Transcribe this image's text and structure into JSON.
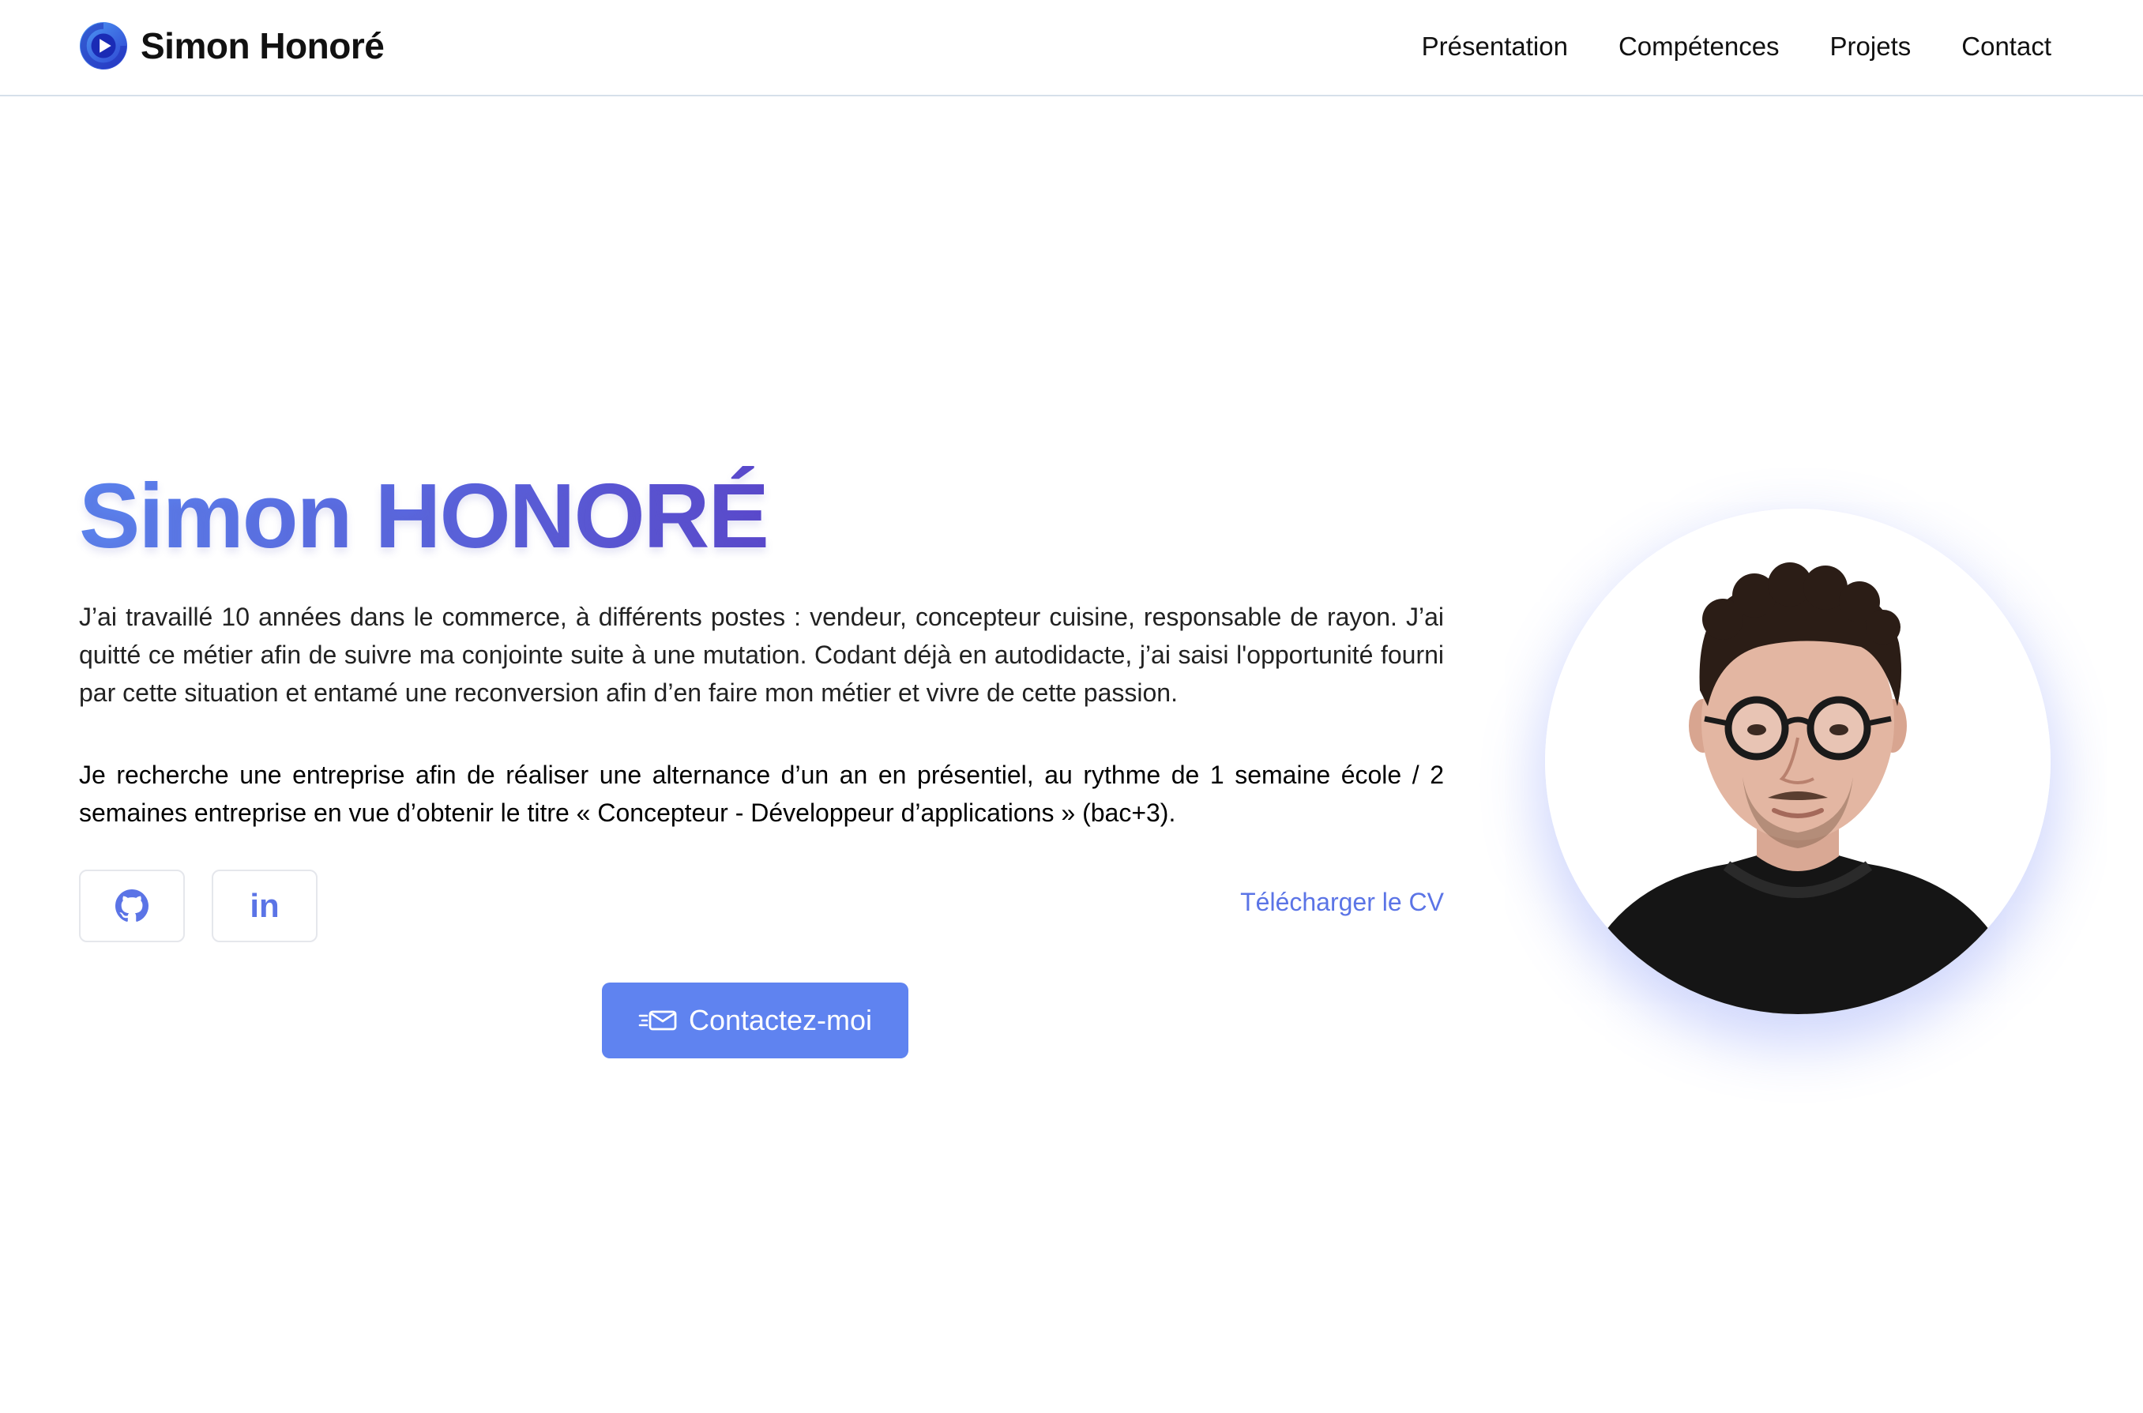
{
  "header": {
    "brand": "Simon Honoré",
    "nav": [
      {
        "label": "Présentation"
      },
      {
        "label": "Compétences"
      },
      {
        "label": "Projets"
      },
      {
        "label": "Contact"
      }
    ]
  },
  "hero": {
    "name": "Simon HONORÉ",
    "bio_paragraph_1": "J’ai travaillé 10 années dans le commerce, à différents postes : vendeur, concepteur cuisine, responsable de rayon. J’ai quitté ce métier afin de suivre ma conjointe suite à une mutation. Codant déjà en autodidacte, j’ai saisi l'opportunité fourni par cette situation et entamé une reconversion afin d’en faire mon métier et vivre de cette passion.",
    "bio_paragraph_2": "Je recherche une entreprise afin de réaliser une alternance d’un an en présentiel, au rythme de 1 semaine école / 2 semaines entreprise en vue d’obtenir le titre « Concepteur - Développeur d’applications » (bac+3).",
    "linkedin_glyph": "in",
    "cv_link": "Télécharger le CV",
    "contact_button": "Contactez-moi"
  },
  "icons": {
    "logo": "play-circle-logo",
    "github": "github-icon",
    "linkedin": "linkedin-icon",
    "contact": "fast-mail-icon"
  },
  "colors": {
    "accent": "#5b74e6",
    "button": "#5f83f0",
    "gradient_start": "#5b84ee",
    "gradient_end": "#5a48cc"
  }
}
